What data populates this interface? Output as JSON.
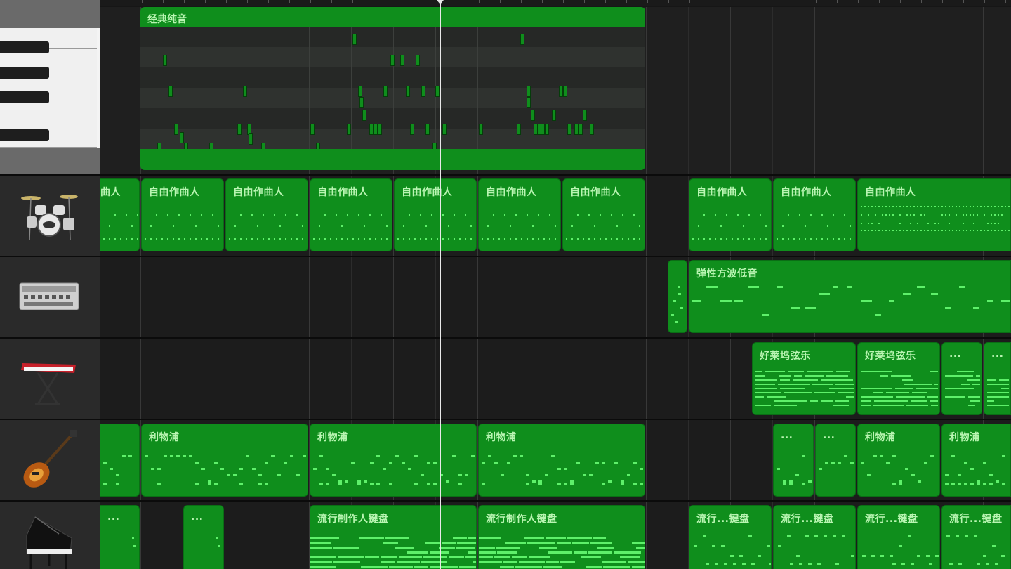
{
  "piano_track": {
    "region_label": "经典纯音"
  },
  "drum_track": {
    "regions": [
      {
        "label": "曲人"
      },
      {
        "label": "自由作曲人"
      },
      {
        "label": "自由作曲人"
      },
      {
        "label": "自由作曲人"
      },
      {
        "label": "自由作曲人"
      },
      {
        "label": "自由作曲人"
      },
      {
        "label": "自由作曲人"
      },
      {
        "label": "自由作曲人"
      },
      {
        "label": "自由作曲人"
      },
      {
        "label": "自由作曲人"
      }
    ]
  },
  "synth_track": {
    "regions": [
      {
        "label": ""
      },
      {
        "label": "弹性方波低音"
      }
    ]
  },
  "keyboard_track": {
    "regions": [
      {
        "label": "好莱坞弦乐"
      },
      {
        "label": "好莱坞弦乐"
      },
      {
        "label": "..."
      },
      {
        "label": "..."
      }
    ]
  },
  "bass_track": {
    "regions": [
      {
        "label": ""
      },
      {
        "label": "利物浦"
      },
      {
        "label": "利物浦"
      },
      {
        "label": "利物浦"
      },
      {
        "label": "..."
      },
      {
        "label": "..."
      },
      {
        "label": "利物浦"
      },
      {
        "label": "利物浦"
      }
    ]
  },
  "grand_piano_track": {
    "regions": [
      {
        "label": "..."
      },
      {
        "label": "..."
      },
      {
        "label": "流行制作人键盘"
      },
      {
        "label": "流行制作人键盘"
      },
      {
        "label": "流行...键盘"
      },
      {
        "label": "流行...键盘"
      },
      {
        "label": "流行...键盘"
      },
      {
        "label": "流行...键盘"
      }
    ]
  },
  "track_icons": [
    "piano-keys-icon",
    "drum-kit-icon",
    "drum-machine-icon",
    "red-synth-keyboard-icon",
    "electric-bass-icon",
    "grand-piano-icon"
  ],
  "colors": {
    "region": "#0f8e1c",
    "note": "#5ef06a",
    "playhead": "#e8e8e8"
  }
}
